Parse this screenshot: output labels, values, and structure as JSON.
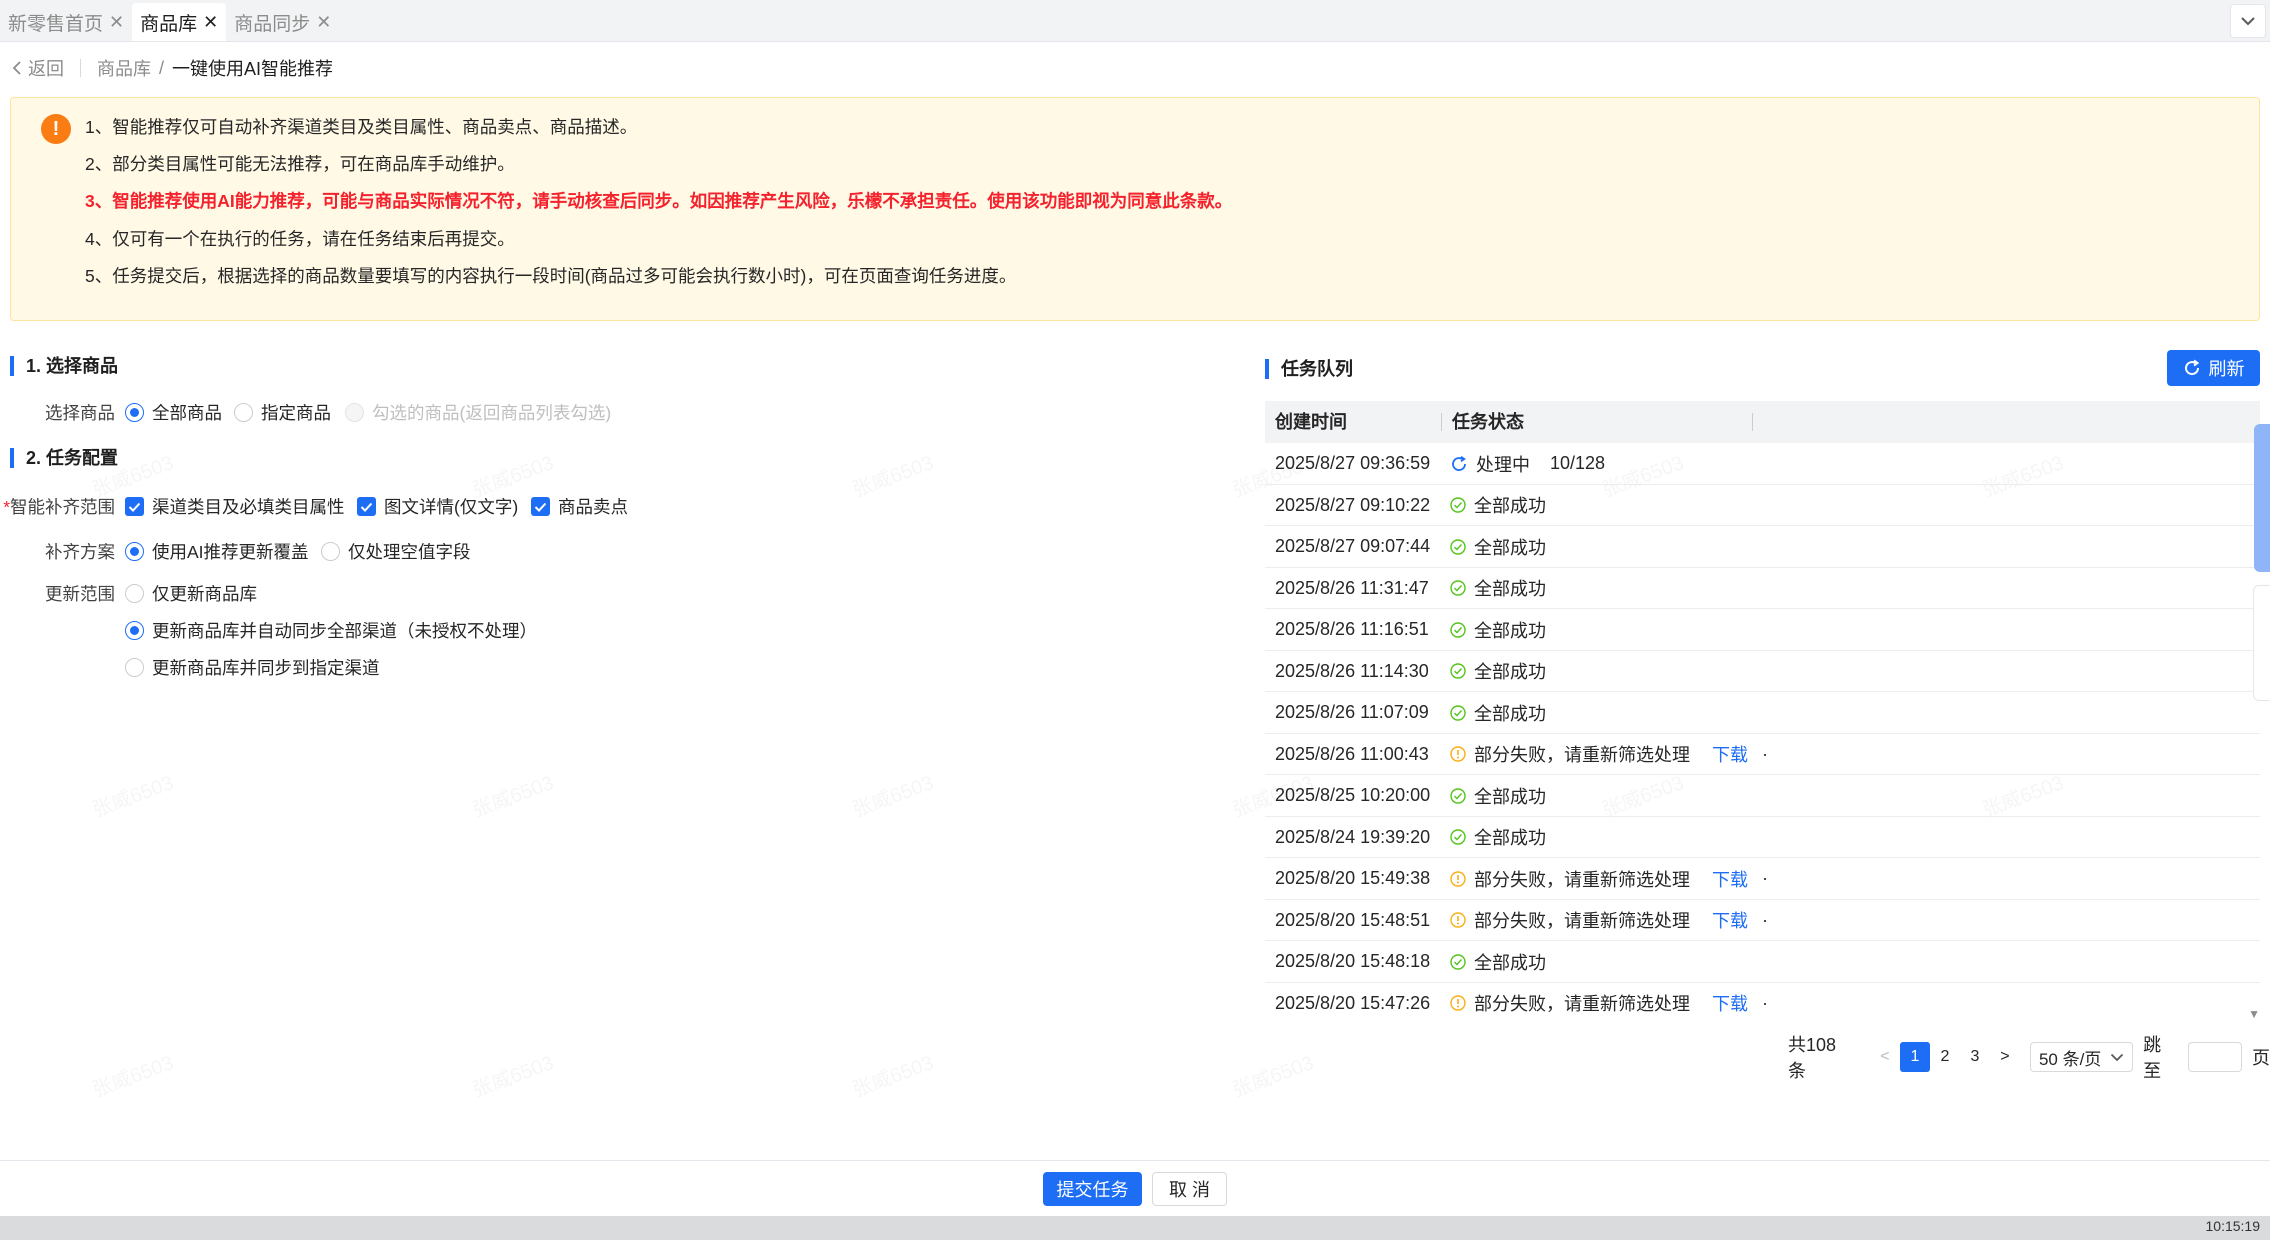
{
  "tabs": [
    {
      "label": "新零售首页",
      "active": false
    },
    {
      "label": "商品库",
      "active": true
    },
    {
      "label": "商品同步",
      "active": false
    }
  ],
  "breadcrumb": {
    "back_label": "返回",
    "parent": "商品库",
    "separator": "/",
    "current": "一键使用AI智能推荐"
  },
  "notice": {
    "icon": "!",
    "lines": [
      "1、智能推荐仅可自动补齐渠道类目及类目属性、商品卖点、商品描述。",
      "2、部分类目属性可能无法推荐，可在商品库手动维护。",
      "3、智能推荐使用AI能力推荐，可能与商品实际情况不符，请手动核查后同步。如因推荐产生风险，乐檬不承担责任。使用该功能即视为同意此条款。",
      "4、仅可有一个在执行的任务，请在任务结束后再提交。",
      "5、任务提交后，根据选择的商品数量要填写的内容执行一段时间(商品过多可能会执行数小时)，可在页面查询任务进度。"
    ]
  },
  "section1": {
    "title": "1. 选择商品",
    "label": "选择商品",
    "options": [
      "全部商品",
      "指定商品",
      "勾选的商品(返回商品列表勾选)"
    ]
  },
  "section2": {
    "title": "2. 任务配置",
    "scope": {
      "required_mark": "*",
      "label": "智能补齐范围",
      "options": [
        "渠道类目及必填类目属性",
        "图文详情(仅文字)",
        "商品卖点"
      ]
    },
    "plan": {
      "label": "补齐方案",
      "options": [
        "使用AI推荐更新覆盖",
        "仅处理空值字段"
      ]
    },
    "range": {
      "label": "更新范围",
      "options": [
        "仅更新商品库",
        "更新商品库并自动同步全部渠道（未授权不处理）",
        "更新商品库并同步到指定渠道"
      ]
    }
  },
  "queue": {
    "title": "任务队列",
    "refresh_label": "刷新",
    "columns": [
      "创建时间",
      "任务状态"
    ],
    "rows": [
      {
        "time": "2025/8/27 09:36:59",
        "status": "processing",
        "text": "处理中",
        "progress": "10/128",
        "link": "",
        "dot": ""
      },
      {
        "time": "2025/8/27 09:10:22",
        "status": "success",
        "text": "全部成功",
        "progress": "",
        "link": "",
        "dot": ""
      },
      {
        "time": "2025/8/27 09:07:44",
        "status": "success",
        "text": "全部成功",
        "progress": "",
        "link": "",
        "dot": ""
      },
      {
        "time": "2025/8/26 11:31:47",
        "status": "success",
        "text": "全部成功",
        "progress": "",
        "link": "",
        "dot": ""
      },
      {
        "time": "2025/8/26 11:16:51",
        "status": "success",
        "text": "全部成功",
        "progress": "",
        "link": "",
        "dot": ""
      },
      {
        "time": "2025/8/26 11:14:30",
        "status": "success",
        "text": "全部成功",
        "progress": "",
        "link": "",
        "dot": ""
      },
      {
        "time": "2025/8/26 11:07:09",
        "status": "success",
        "text": "全部成功",
        "progress": "",
        "link": "",
        "dot": ""
      },
      {
        "time": "2025/8/26 11:00:43",
        "status": "partial",
        "text": "部分失败，请重新筛选处理",
        "progress": "",
        "link": "下载",
        "dot": "·"
      },
      {
        "time": "2025/8/25 10:20:00",
        "status": "success",
        "text": "全部成功",
        "progress": "",
        "link": "",
        "dot": ""
      },
      {
        "time": "2025/8/24 19:39:20",
        "status": "success",
        "text": "全部成功",
        "progress": "",
        "link": "",
        "dot": ""
      },
      {
        "time": "2025/8/20 15:49:38",
        "status": "partial",
        "text": "部分失败，请重新筛选处理",
        "progress": "",
        "link": "下载",
        "dot": "·"
      },
      {
        "time": "2025/8/20 15:48:51",
        "status": "partial",
        "text": "部分失败，请重新筛选处理",
        "progress": "",
        "link": "下载",
        "dot": "·"
      },
      {
        "time": "2025/8/20 15:48:18",
        "status": "success",
        "text": "全部成功",
        "progress": "",
        "link": "",
        "dot": ""
      },
      {
        "time": "2025/8/20 15:47:26",
        "status": "partial",
        "text": "部分失败，请重新筛选处理",
        "progress": "",
        "link": "下载",
        "dot": "·"
      }
    ]
  },
  "pagination": {
    "total": "共108条",
    "pages": [
      "1",
      "2",
      "3"
    ],
    "current": "1",
    "size": "50 条/页",
    "jump_label": "跳至",
    "page_suffix": "页"
  },
  "footer": {
    "submit_label": "提交任务",
    "cancel_label": "取 消"
  },
  "taskbar": {
    "clock": "10:15:19"
  },
  "watermark": "张威6503",
  "colors": {
    "primary": "#1d6ef5",
    "success": "#52c41a",
    "warning": "#faad14",
    "danger": "#f5222d",
    "notice_bg": "#fff9e6"
  }
}
